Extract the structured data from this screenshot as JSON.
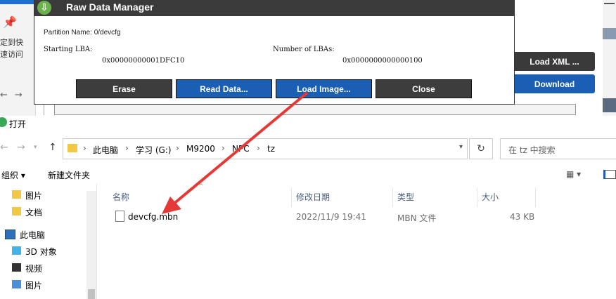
{
  "background": {
    "left_text_1": "定到快",
    "left_text_2": "速访问",
    "side_buttons": {
      "load_xml": "Load XML ...",
      "download": "Download"
    }
  },
  "raw_dialog": {
    "title": "Raw Data Manager",
    "partition": "Partition Name: 0/devcfg",
    "starting_lba_label": "Starting LBA:",
    "starting_lba_value": "0x00000000001DFC10",
    "num_lbas_label": "Number of LBAs:",
    "num_lbas_value": "0x0000000000000100",
    "buttons": {
      "erase": "Erase",
      "read": "Read Data...",
      "load": "Load Image...",
      "close": "Close"
    }
  },
  "open_dialog": {
    "title": "打开",
    "breadcrumbs": [
      "此电脑",
      "学习 (G:)",
      "M9200",
      "NPC",
      "tz"
    ],
    "search_placeholder": "在 tz 中搜索",
    "toolbar": {
      "organize": "组织 ▾",
      "new_folder": "新建文件夹"
    },
    "nav_items": [
      {
        "label": "图片",
        "icon": "folder-icon"
      },
      {
        "label": "文档",
        "icon": "folder-icon"
      },
      {
        "label": "此电脑",
        "icon": "computer-icon"
      },
      {
        "label": "3D 对象",
        "icon": "cube-icon"
      },
      {
        "label": "视频",
        "icon": "video-icon"
      },
      {
        "label": "图片",
        "icon": "picture-icon"
      }
    ],
    "columns": [
      "名称",
      "修改日期",
      "类型",
      "大小"
    ],
    "files": [
      {
        "name": "devcfg.mbn",
        "date": "2022/11/9 19:41",
        "type": "MBN 文件",
        "size": "43 KB"
      }
    ]
  },
  "colors": {
    "accent_blue": "#1a5fb4",
    "dark_button": "#3d3d3d",
    "arrow": "#e53935"
  }
}
